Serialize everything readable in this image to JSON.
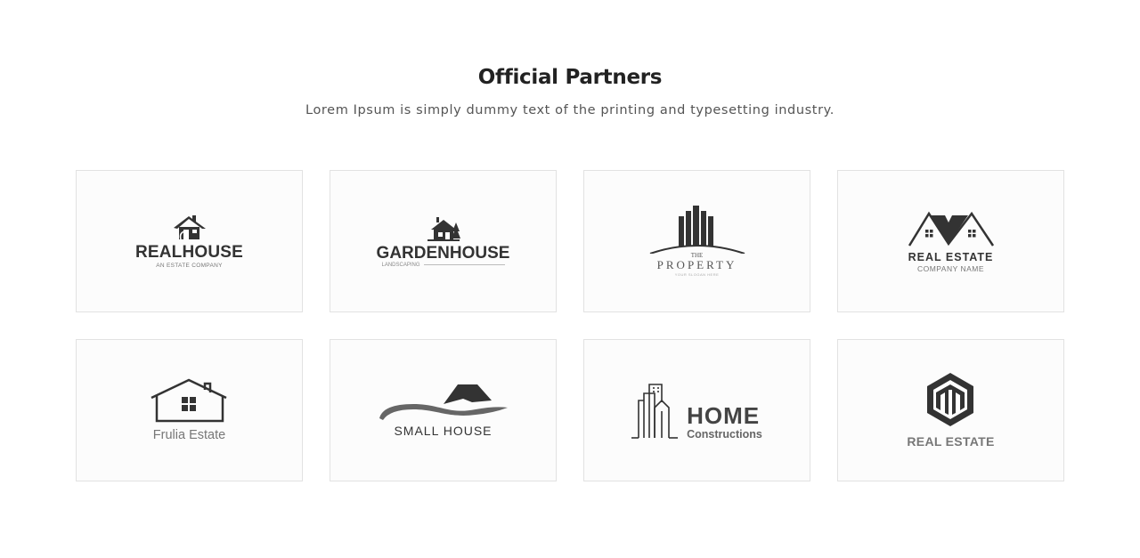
{
  "section": {
    "title": "Official Partners",
    "subtitle": "Lorem Ipsum is simply dummy text of the printing and typesetting industry."
  },
  "partners": [
    {
      "icon": "house-chimney-icon",
      "name": "REALHOUSE",
      "tagline": "AN ESTATE COMPANY"
    },
    {
      "icon": "garden-house-icon",
      "name": "GARDENHOUSE",
      "tagline": "LANDSCAPING"
    },
    {
      "icon": "skyscraper-icon",
      "small": "THE",
      "name": "PROPERTY",
      "tagline": "YOUR SLOGAN HERE"
    },
    {
      "icon": "double-roof-icon",
      "name": "REAL ESTATE",
      "tagline": "COMPANY NAME"
    },
    {
      "icon": "house-outline-icon",
      "name": "Frulia Estate"
    },
    {
      "icon": "wave-roof-icon",
      "name": "SMALL HOUSE"
    },
    {
      "icon": "building-lines-icon",
      "name": "HOME",
      "tagline": "Constructions"
    },
    {
      "icon": "hexagon-building-icon",
      "name": "REAL ESTATE"
    }
  ],
  "colors": {
    "logo_dark": "#333333",
    "logo_gray": "#777777",
    "card_border": "#e2e2e2",
    "card_bg": "#fcfcfc"
  }
}
